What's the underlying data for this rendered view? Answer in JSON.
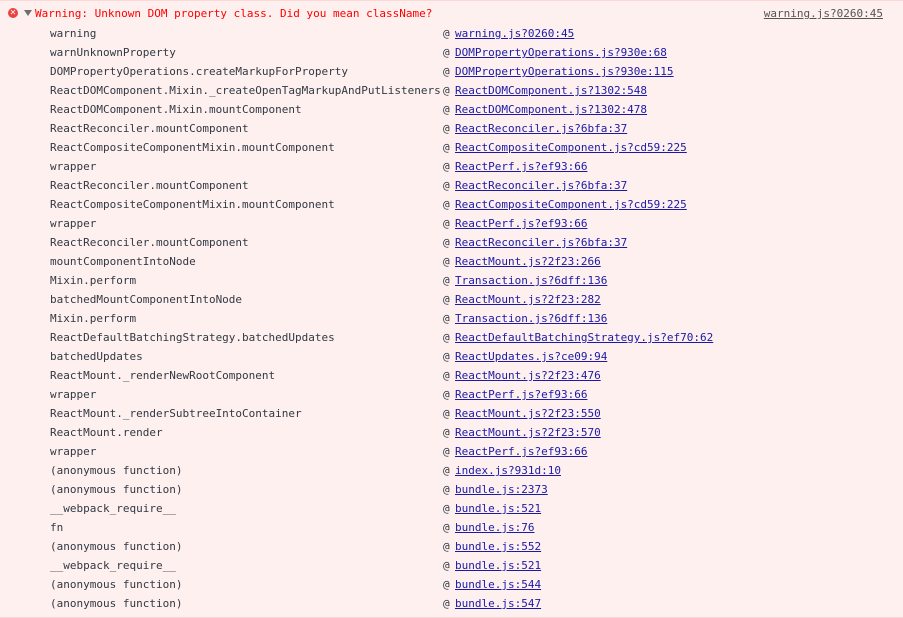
{
  "message": {
    "icon": "error-circle-icon",
    "text": "Warning: Unknown DOM property class. Did you mean className?",
    "source": "warning.js?0260:45"
  },
  "stack": [
    {
      "fn": "warning",
      "at": "@",
      "link": "warning.js?0260:45"
    },
    {
      "fn": "warnUnknownProperty",
      "at": "@",
      "link": "DOMPropertyOperations.js?930e:68"
    },
    {
      "fn": "DOMPropertyOperations.createMarkupForProperty",
      "at": "@",
      "link": "DOMPropertyOperations.js?930e:115"
    },
    {
      "fn": "ReactDOMComponent.Mixin._createOpenTagMarkupAndPutListeners",
      "at": "@",
      "link": "ReactDOMComponent.js?1302:548"
    },
    {
      "fn": "ReactDOMComponent.Mixin.mountComponent",
      "at": "@",
      "link": "ReactDOMComponent.js?1302:478"
    },
    {
      "fn": "ReactReconciler.mountComponent",
      "at": "@",
      "link": "ReactReconciler.js?6bfa:37"
    },
    {
      "fn": "ReactCompositeComponentMixin.mountComponent",
      "at": "@",
      "link": "ReactCompositeComponent.js?cd59:225"
    },
    {
      "fn": "wrapper",
      "at": "@",
      "link": "ReactPerf.js?ef93:66"
    },
    {
      "fn": "ReactReconciler.mountComponent",
      "at": "@",
      "link": "ReactReconciler.js?6bfa:37"
    },
    {
      "fn": "ReactCompositeComponentMixin.mountComponent",
      "at": "@",
      "link": "ReactCompositeComponent.js?cd59:225"
    },
    {
      "fn": "wrapper",
      "at": "@",
      "link": "ReactPerf.js?ef93:66"
    },
    {
      "fn": "ReactReconciler.mountComponent",
      "at": "@",
      "link": "ReactReconciler.js?6bfa:37"
    },
    {
      "fn": "mountComponentIntoNode",
      "at": "@",
      "link": "ReactMount.js?2f23:266"
    },
    {
      "fn": "Mixin.perform",
      "at": "@",
      "link": "Transaction.js?6dff:136"
    },
    {
      "fn": "batchedMountComponentIntoNode",
      "at": "@",
      "link": "ReactMount.js?2f23:282"
    },
    {
      "fn": "Mixin.perform",
      "at": "@",
      "link": "Transaction.js?6dff:136"
    },
    {
      "fn": "ReactDefaultBatchingStrategy.batchedUpdates",
      "at": "@",
      "link": "ReactDefaultBatchingStrategy.js?ef70:62"
    },
    {
      "fn": "batchedUpdates",
      "at": "@",
      "link": "ReactUpdates.js?ce09:94"
    },
    {
      "fn": "ReactMount._renderNewRootComponent",
      "at": "@",
      "link": "ReactMount.js?2f23:476"
    },
    {
      "fn": "wrapper",
      "at": "@",
      "link": "ReactPerf.js?ef93:66"
    },
    {
      "fn": "ReactMount._renderSubtreeIntoContainer",
      "at": "@",
      "link": "ReactMount.js?2f23:550"
    },
    {
      "fn": "ReactMount.render",
      "at": "@",
      "link": "ReactMount.js?2f23:570"
    },
    {
      "fn": "wrapper",
      "at": "@",
      "link": "ReactPerf.js?ef93:66"
    },
    {
      "fn": "(anonymous function)",
      "at": "@",
      "link": "index.js?931d:10"
    },
    {
      "fn": "(anonymous function)",
      "at": "@",
      "link": "bundle.js:2373"
    },
    {
      "fn": "__webpack_require__",
      "at": "@",
      "link": "bundle.js:521"
    },
    {
      "fn": "fn",
      "at": "@",
      "link": "bundle.js:76"
    },
    {
      "fn": "(anonymous function)",
      "at": "@",
      "link": "bundle.js:552"
    },
    {
      "fn": "__webpack_require__",
      "at": "@",
      "link": "bundle.js:521"
    },
    {
      "fn": "(anonymous function)",
      "at": "@",
      "link": "bundle.js:544"
    },
    {
      "fn": "(anonymous function)",
      "at": "@",
      "link": "bundle.js:547"
    }
  ]
}
